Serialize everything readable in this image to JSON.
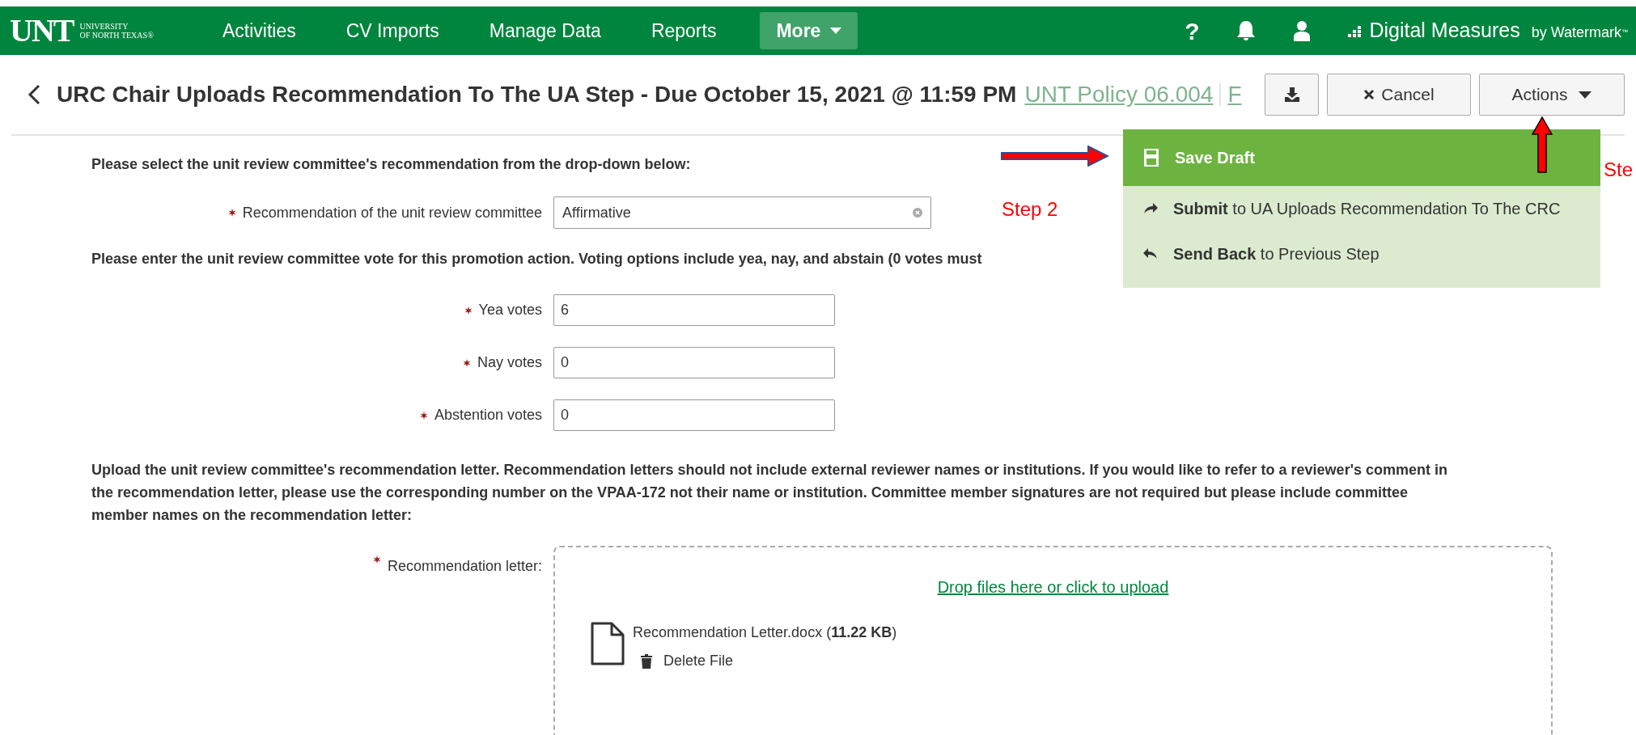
{
  "nav": {
    "logo": "UNT",
    "logo_sub": [
      "UNIVERSITY",
      "OF NORTH TEXAS"
    ],
    "logo_mark": "®",
    "items": [
      {
        "label": "Activities",
        "kind": "link"
      },
      {
        "label": "CV Imports",
        "kind": "link"
      },
      {
        "label": "Manage Data",
        "kind": "link"
      },
      {
        "label": "Reports",
        "kind": "link"
      },
      {
        "label": "More",
        "kind": "menu"
      }
    ],
    "help": "?",
    "brand": "Digital Measures",
    "brand_by": "by Watermark",
    "brand_tm": "™"
  },
  "page": {
    "title": "URC Chair Uploads Recommendation To The UA Step - Due October 15, 2021 @ 11:59 PM",
    "faint_links": [
      "UNT Policy 06.004",
      "F"
    ],
    "cancel": "Cancel",
    "actions": "Actions"
  },
  "actions_menu": [
    {
      "label": "**Save Draft**",
      "selected": true
    },
    {
      "label": "**Submit** to UA Uploads Recommendation To The CRC",
      "selected": false
    },
    {
      "label": "**Send Back** to Previous Step",
      "selected": false
    }
  ],
  "form": {
    "select_heading": "Please select the unit review committee's recommendation from the drop-down below:",
    "recommendation": {
      "label": "Recommendation of the unit review committee",
      "value": "Affirmative",
      "required": true
    },
    "vote_heading": "Please enter the unit review committee vote for this promotion action.  Voting options include yea, nay, and abstain (0 votes must",
    "votes": [
      {
        "label": "Yea votes",
        "value": "6",
        "required": true
      },
      {
        "label": "Nay votes",
        "value": "0",
        "required": true
      },
      {
        "label": "Abstention votes",
        "value": "0",
        "required": true
      }
    ],
    "upload_heading": "Upload the unit review committee's recommendation letter. Recommendation letters should not include external reviewer names or institutions.  If you would like to refer to a reviewer's comment in the recommendation letter, please use the corresponding number on the VPAA-172 not their name or institution. Committee member signatures are not required but please include committee member names on the recommendation letter:",
    "letter": {
      "label": "Recommendation letter:",
      "required": true,
      "drop_text": "Drop files here or click to upload",
      "file": "Recommendation Letter.docx (**11.22 KB**)",
      "delete": "Delete File"
    }
  },
  "annotations": [
    {
      "kind": "arrow-right"
    },
    {
      "kind": "text",
      "text": "Step 2"
    },
    {
      "kind": "arrow-up"
    },
    {
      "kind": "text",
      "text": "Ste"
    }
  ]
}
